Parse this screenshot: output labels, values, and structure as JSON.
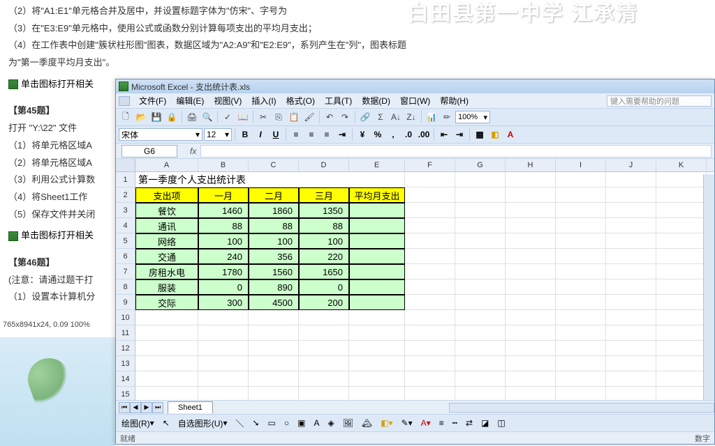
{
  "header_overlay": "白田县第一中学 江承清",
  "doc": {
    "l2": "（2）将\"A1:E1\"单元格合并及居中，并设置标题字体为\"仿宋\"、字号为",
    "l3": "（3）在\"E3:E9\"单元格中，使用公式或函数分别计算每项支出的平均月支出；",
    "l4": "（4）在工作表中创建\"簇状柱形图\"图表，数据区域为\"A2:A9\"和\"E2:E9\"，系列产生在\"列\"，图表标题",
    "l4b": "为\"第一季度平均月支出\"。",
    "link1": "单击图标打开相关",
    "q45": "【第45题】",
    "q45_1": "打开 \"Y:\\22\" 文件",
    "q45_2": "（1）将单元格区域A",
    "q45_3": "（2）将单元格区域A",
    "q45_4": "（3）利用公式计算数",
    "q45_5": "（4）将Sheet1工作",
    "q45_6": "（5）保存文件并关闭",
    "link2": "单击图标打开相关",
    "q46": "【第46题】",
    "q46_1": "(注意：请通过题干打",
    "q46_2": "（1）设置本计算机分",
    "status": "765x8941x24, 0.09   100%"
  },
  "excel": {
    "title": "Microsoft Excel - 支出统计表.xls",
    "menus": [
      "文件(F)",
      "编辑(E)",
      "视图(V)",
      "插入(I)",
      "格式(O)",
      "工具(T)",
      "数据(D)",
      "窗口(W)",
      "帮助(H)"
    ],
    "help_placeholder": "键入需要帮助的问题",
    "zoom": "100%",
    "font": "宋体",
    "size": "12",
    "namebox": "G6",
    "cols": [
      "A",
      "B",
      "C",
      "D",
      "E",
      "F",
      "G",
      "H",
      "I",
      "J",
      "K"
    ],
    "rows": [
      "1",
      "2",
      "3",
      "4",
      "5",
      "6",
      "7",
      "8",
      "9",
      "10",
      "11",
      "12",
      "13",
      "14",
      "15"
    ],
    "table_title": "第一季度个人支出统计表",
    "headers": [
      "支出项",
      "一月",
      "二月",
      "三月",
      "平均月支出"
    ],
    "data": [
      [
        "餐饮",
        "1460",
        "1860",
        "1350",
        ""
      ],
      [
        "通讯",
        "88",
        "88",
        "88",
        ""
      ],
      [
        "网络",
        "100",
        "100",
        "100",
        ""
      ],
      [
        "交通",
        "240",
        "356",
        "220",
        ""
      ],
      [
        "房租水电",
        "1780",
        "1560",
        "1650",
        ""
      ],
      [
        "服装",
        "0",
        "890",
        "0",
        ""
      ],
      [
        "交际",
        "300",
        "4500",
        "200",
        ""
      ]
    ],
    "sheet": "Sheet1",
    "drawbar": {
      "label": "绘图(R)",
      "auto": "自选图形(U)"
    },
    "status": {
      "left": "就绪",
      "right": "数字"
    }
  }
}
